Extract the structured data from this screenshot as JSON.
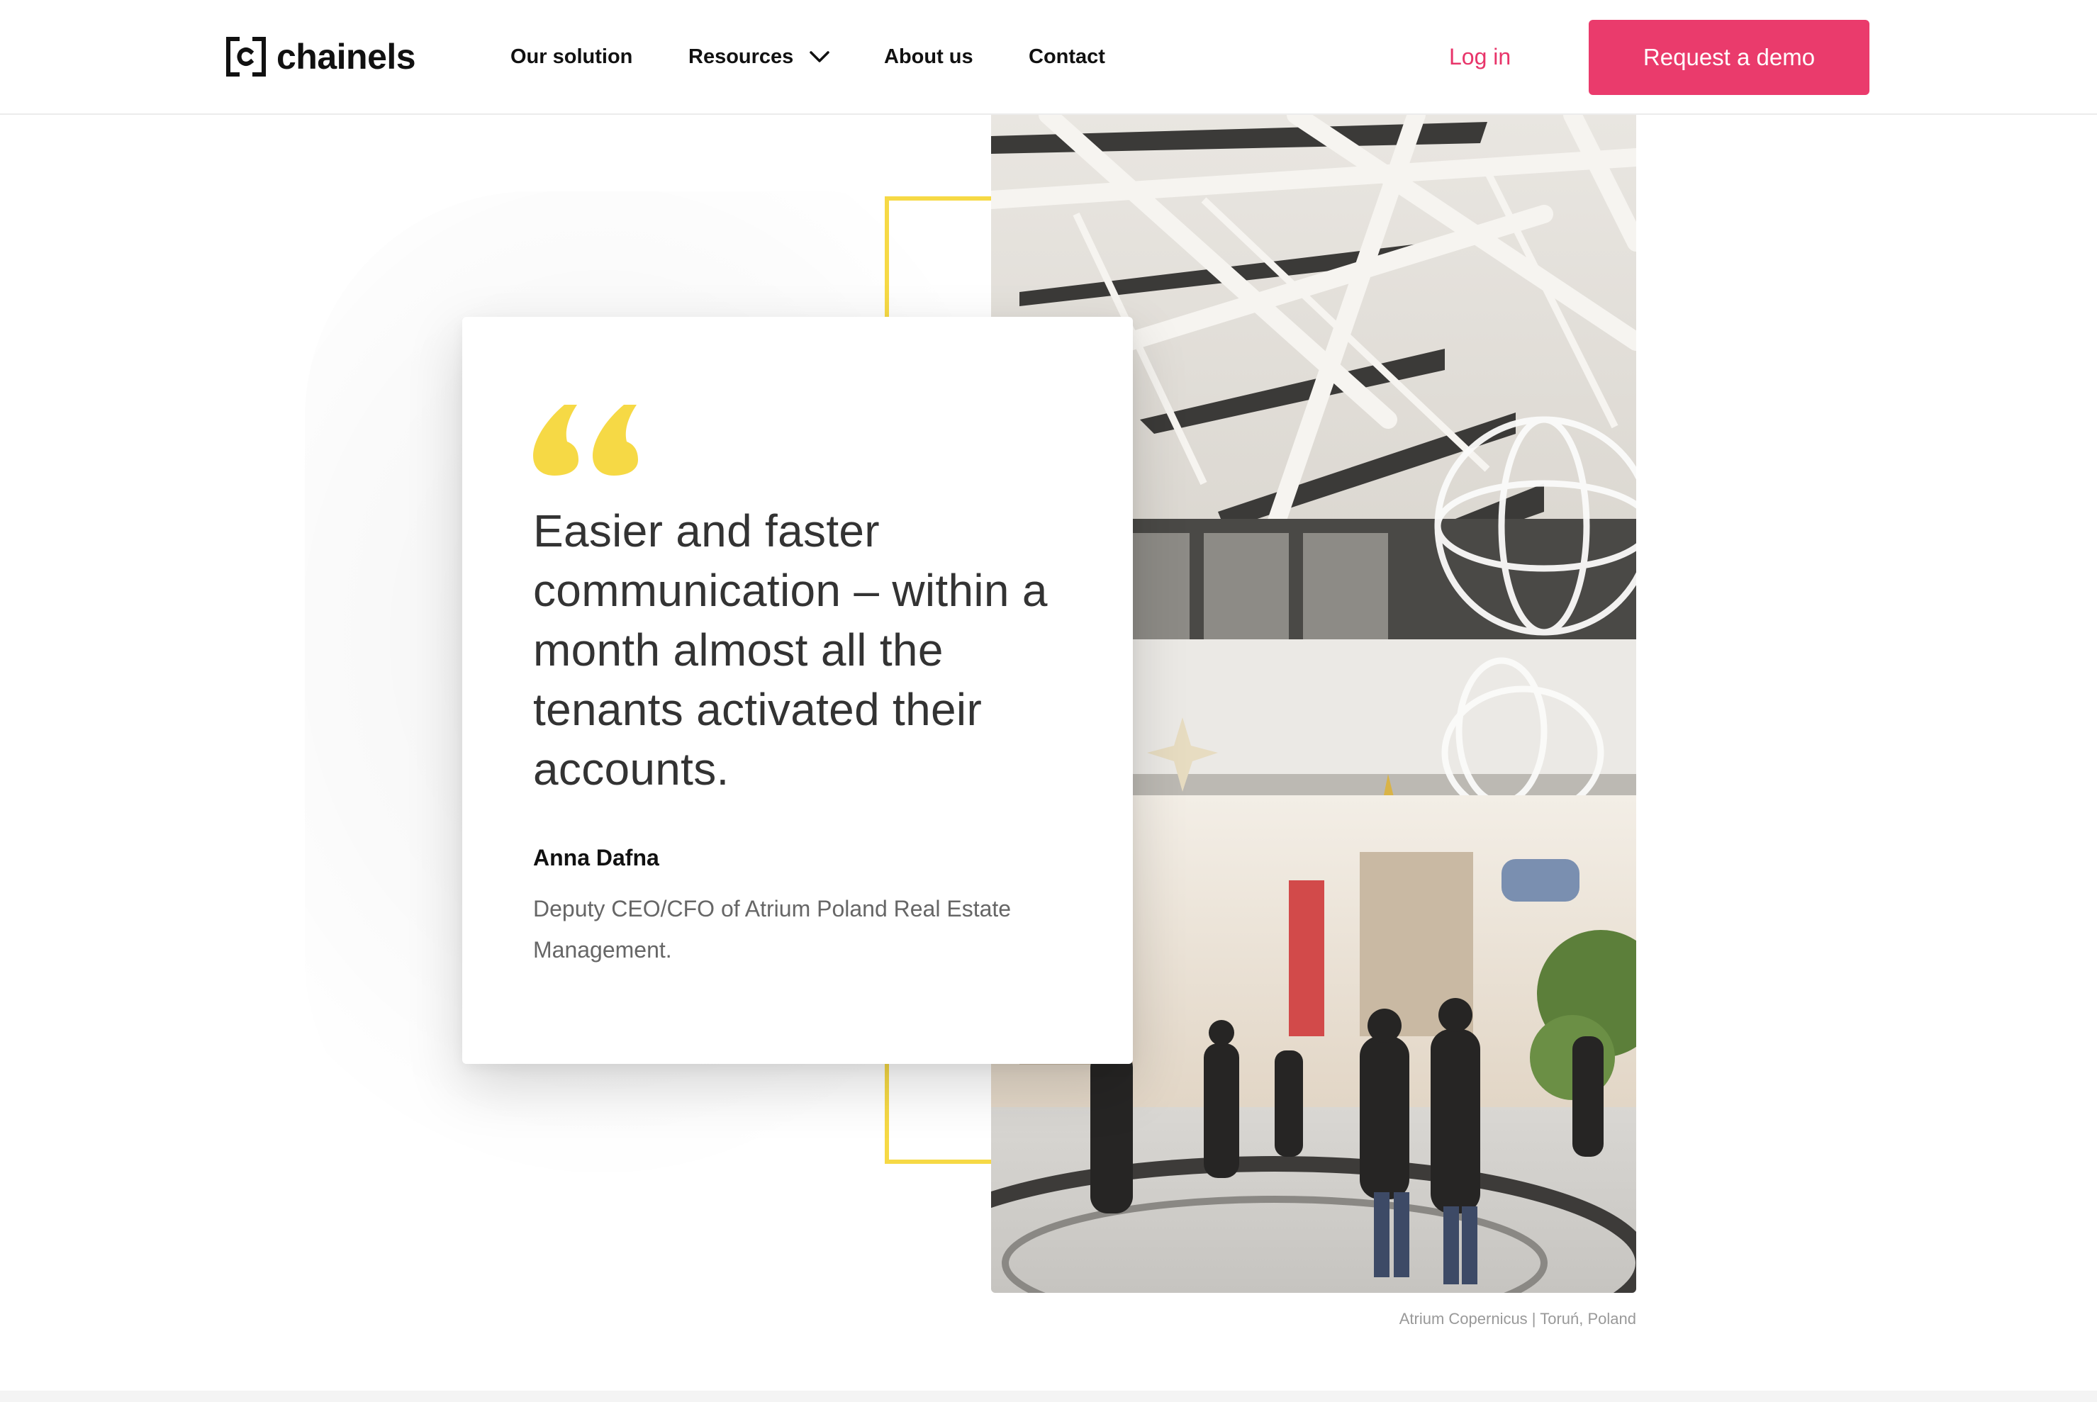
{
  "brand": {
    "name": "chainels",
    "accent_color": "#ea3b6c",
    "highlight_color": "#f6d945"
  },
  "nav": {
    "items": [
      {
        "label": "Our solution"
      },
      {
        "label": "Resources",
        "icon": "chevron-down-icon"
      },
      {
        "label": "About us"
      },
      {
        "label": "Contact"
      }
    ],
    "login_label": "Log in",
    "cta_label": "Request a demo"
  },
  "testimonial": {
    "quote_icon": "quote-icon",
    "quote": "Easier and faster communication – within a month almost all the tenants activated their accounts.",
    "author": "Anna Dafna",
    "role": "Deputy CEO/CFO of Atrium Poland Real Estate Management."
  },
  "photo": {
    "caption": "Atrium Copernicus | Toruń, Poland"
  }
}
